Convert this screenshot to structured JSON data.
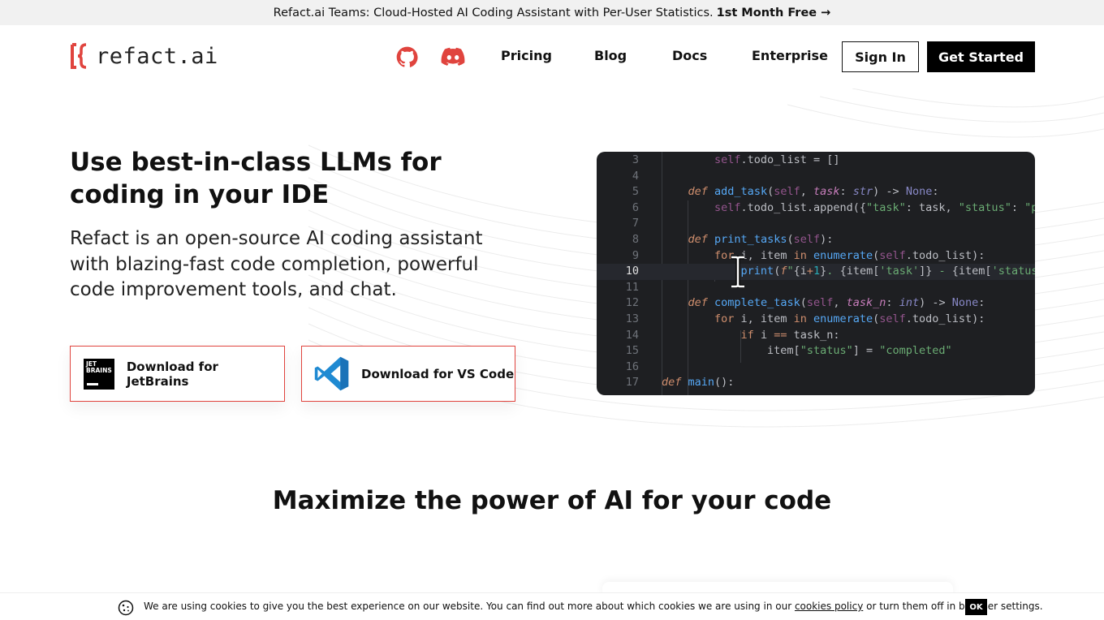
{
  "banner": {
    "text": "Refact.ai Teams: Cloud-Hosted AI Coding Assistant with Per-User Statistics.",
    "cta": "1st Month Free →"
  },
  "header": {
    "logo_text": "refact.ai",
    "nav": [
      "Pricing",
      "Blog",
      "Docs",
      "Enterprise"
    ],
    "sign_in": "Sign In",
    "get_started": "Get Started",
    "icons": [
      "github-icon",
      "discord-icon"
    ],
    "brand_color": "#e0443e"
  },
  "hero": {
    "title": "Use best-in-class LLMs for coding in your IDE",
    "subtitle": "Refact is an open-source AI coding assistant with blazing-fast code completion, powerful code improvement tools, and chat.",
    "download_jetbrains": "Download for JetBrains",
    "download_vscode": "Download for VS Code",
    "jetbrains_logo_text": "JET BRAINS"
  },
  "editor": {
    "line_numbers": [
      "3",
      "4",
      "5",
      "6",
      "7",
      "8",
      "9",
      "10",
      "11",
      "12",
      "13",
      "14",
      "15",
      "16",
      "17"
    ],
    "current_line": "10"
  },
  "section": {
    "title": "Maximize the power of AI for your code"
  },
  "cookie": {
    "text_before": "We are using cookies to give you the best experience on our website. You can find out more about which cookies we are using in our",
    "link": "cookies policy",
    "text_after": "or turn them off in browser settings.",
    "ok": "OK"
  }
}
